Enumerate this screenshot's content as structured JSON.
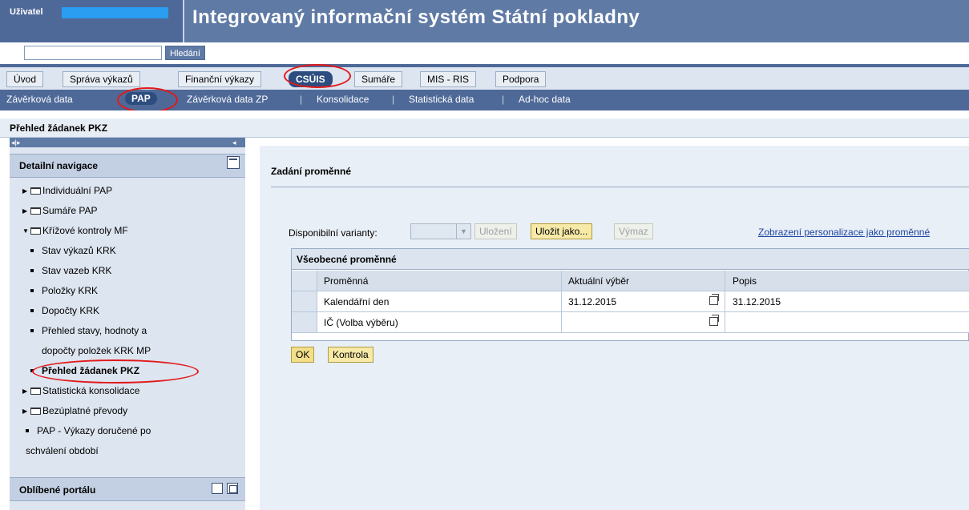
{
  "header": {
    "user_label": "Uživatel",
    "app_title": "Integrovaný informační systém Státní pokladny",
    "search_button": "Hledání",
    "search_value": ""
  },
  "tabs": [
    {
      "label": "Úvod"
    },
    {
      "label": "Správa výkazů"
    },
    {
      "label": "Finanční výkazy"
    },
    {
      "label": "CSÚIS",
      "active": true
    },
    {
      "label": "Sumáře"
    },
    {
      "label": "MIS - RIS"
    },
    {
      "label": "Podpora"
    }
  ],
  "subnav": [
    {
      "label": "Závěrková data"
    },
    {
      "label": "PAP",
      "active": true
    },
    {
      "label": "Závěrková data ZP"
    },
    {
      "label": "Konsolidace"
    },
    {
      "label": "Statistická data"
    },
    {
      "label": "Ad-hoc data"
    }
  ],
  "subnav_separator": "|",
  "breadcrumb": "Přehled žádanek PKZ",
  "left_panel": {
    "title": "Detailní navigace",
    "items": [
      {
        "label": "Individuální PAP"
      },
      {
        "label": "Sumáře PAP"
      },
      {
        "label": "Křížové kontroly MF"
      },
      {
        "label": "Stav výkazů KRK"
      },
      {
        "label": "Stav vazeb KRK"
      },
      {
        "label": "Položky KRK"
      },
      {
        "label": "Dopočty KRK"
      },
      {
        "label": "Přehled stavy, hodnoty a"
      },
      {
        "label": "dopočty položek KRK MP"
      },
      {
        "label": "Přehled žádanek PKZ"
      },
      {
        "label": "Statistická konsolidace"
      },
      {
        "label": "Bezúplatné převody"
      },
      {
        "label": "PAP - Výkazy doručené po"
      },
      {
        "label": "schválení období"
      }
    ],
    "favorites_title": "Oblíbené portálu"
  },
  "main": {
    "section_title": "Zadání proměnné",
    "variants_label": "Disponibilní varianty:",
    "variants_value": "",
    "buttons": {
      "save": "Uložení",
      "save_as": "Uložit jako...",
      "delete": "Výmaz",
      "ok": "OK",
      "check": "Kontrola"
    },
    "personalize_link": "Zobrazení personalizace jako proměnné",
    "grid": {
      "caption": "Všeobecné proměnné",
      "columns": [
        "Proměnná",
        "Aktuální výběr",
        "Popis"
      ],
      "rows": [
        {
          "variable": "Kalendářní den",
          "selection": "31.12.2015",
          "description": "31.12.2015"
        },
        {
          "variable": "IČ (Volba výběru)",
          "selection": "",
          "description": ""
        }
      ]
    }
  }
}
